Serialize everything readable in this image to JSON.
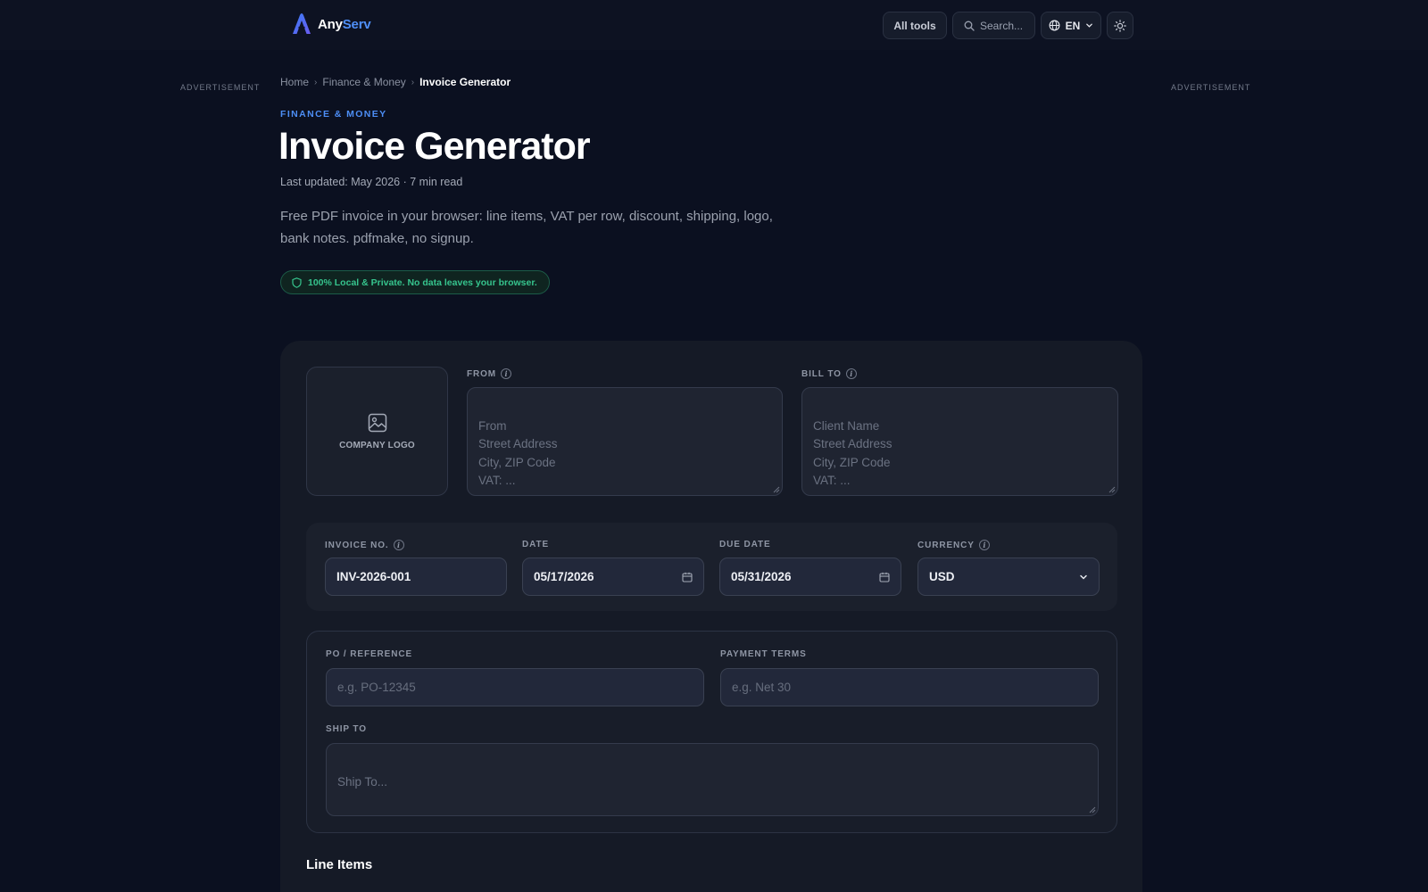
{
  "header": {
    "brand_part1": "Any",
    "brand_part2": "Serv",
    "all_tools": "All tools",
    "search_placeholder": "Search...",
    "language": "EN",
    "accent_color": "#4f8ff7"
  },
  "ads": {
    "left": "ADVERTISEMENT",
    "right": "ADVERTISEMENT"
  },
  "breadcrumb": {
    "home": "Home",
    "category": "Finance & Money",
    "current": "Invoice Generator",
    "separator": "›"
  },
  "page": {
    "kicker": "FINANCE & MONEY",
    "title": "Invoice Generator",
    "meta": "Last updated: May 2026 · 7 min read",
    "description": "Free PDF invoice in your browser: line items, VAT per row, discount, shipping, logo, bank notes. pdfmake, no signup.",
    "privacy_badge": "100% Local & Private. No data leaves your browser.",
    "privacy_color": "#36c48d"
  },
  "form": {
    "logo_label": "COMPANY LOGO",
    "from_label": "FROM",
    "from_placeholder": "From\nStreet Address\nCity, ZIP Code\nVAT: ...",
    "bill_to_label": "BILL TO",
    "bill_to_placeholder": "Client Name\nStreet Address\nCity, ZIP Code\nVAT: ...",
    "invoice_no_label": "INVOICE NO.",
    "invoice_no_value": "INV-2026-001",
    "date_label": "DATE",
    "date_value": "05/17/2026",
    "due_date_label": "DUE DATE",
    "due_date_value": "05/31/2026",
    "currency_label": "CURRENCY",
    "currency_value": "USD",
    "po_label": "PO / REFERENCE",
    "po_placeholder": "e.g. PO-12345",
    "terms_label": "PAYMENT TERMS",
    "terms_placeholder": "e.g. Net 30",
    "ship_to_label": "SHIP TO",
    "ship_to_placeholder": "Ship To..."
  },
  "sections": {
    "line_items": "Line Items"
  }
}
